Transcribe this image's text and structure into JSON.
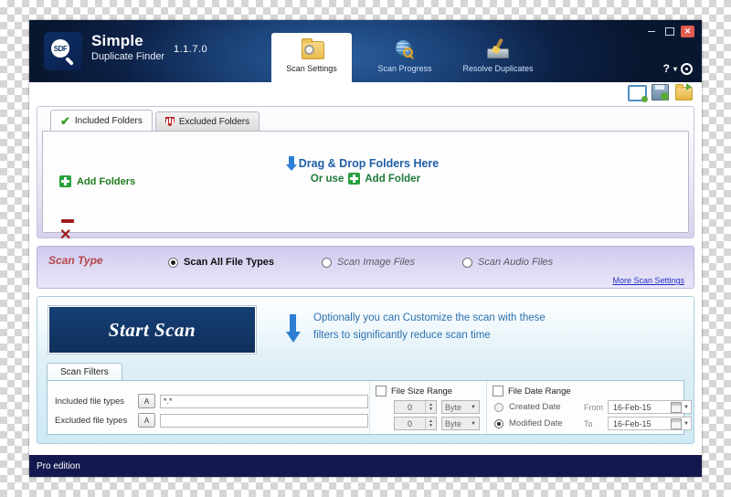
{
  "window": {
    "controls": {
      "minimize": "–",
      "maximize": "□",
      "close": "✕"
    },
    "help": "?",
    "help_caret": "▾"
  },
  "header": {
    "brand_line1": "Simple",
    "brand_line2": "Duplicate Finder",
    "version": "1.1.7.0",
    "logo_text": "SDF",
    "tabs": [
      {
        "label": "Scan Settings",
        "icon": "folder-gear-icon",
        "active": true
      },
      {
        "label": "Scan Progress",
        "icon": "globe-magnifier-icon",
        "active": false
      },
      {
        "label": "Resolve Duplicates",
        "icon": "broom-disk-icon",
        "active": false
      }
    ]
  },
  "toolbar": {
    "icons": [
      {
        "name": "new-project-icon",
        "title": "New"
      },
      {
        "name": "save-project-icon",
        "title": "Save"
      },
      {
        "name": "open-project-icon",
        "title": "Open"
      }
    ]
  },
  "folders_panel": {
    "tabs": [
      {
        "label": "Included Folders",
        "icon": "green-check-icon",
        "active": true
      },
      {
        "label": "Excluded Folders",
        "icon": "red-shield-icon",
        "active": false
      }
    ],
    "add_folders_label": "Add Folders",
    "remove_label": "–",
    "clear_label": "✕",
    "dropzone_line1": "Drag & Drop Folders Here",
    "dropzone_or": "Or use",
    "dropzone_add": "Add Folder"
  },
  "scan_type": {
    "title": "Scan Type",
    "options": [
      {
        "label": "Scan All File Types",
        "selected": true
      },
      {
        "label": "Scan Image Files",
        "selected": false
      },
      {
        "label": "Scan Audio Files",
        "selected": false
      }
    ],
    "more_link": "More Scan Settings"
  },
  "scan_action": {
    "start_button": "Start Scan",
    "note_line1": "Optionally you can Customize the scan with these",
    "note_line2": "filters to significantly reduce scan time"
  },
  "scan_filters": {
    "tab_label": "Scan Filters",
    "included_label": "Included file types",
    "included_value": "*.*",
    "excluded_label": "Excluded file types",
    "excluded_value": "",
    "a_button": "A",
    "file_size": {
      "group_label": "File Size Range",
      "min_value": "0",
      "max_value": "0",
      "min_unit": "Byte",
      "max_unit": "Byte"
    },
    "file_date": {
      "group_label": "File Date Range",
      "created_label": "Created Date",
      "created_selected": false,
      "modified_label": "Modified Date",
      "modified_selected": true,
      "from_label": "From",
      "to_label": "To",
      "from_value": "16-Feb-15",
      "to_value": "16-Feb-15"
    }
  },
  "status_bar": {
    "text": "Pro edition"
  }
}
